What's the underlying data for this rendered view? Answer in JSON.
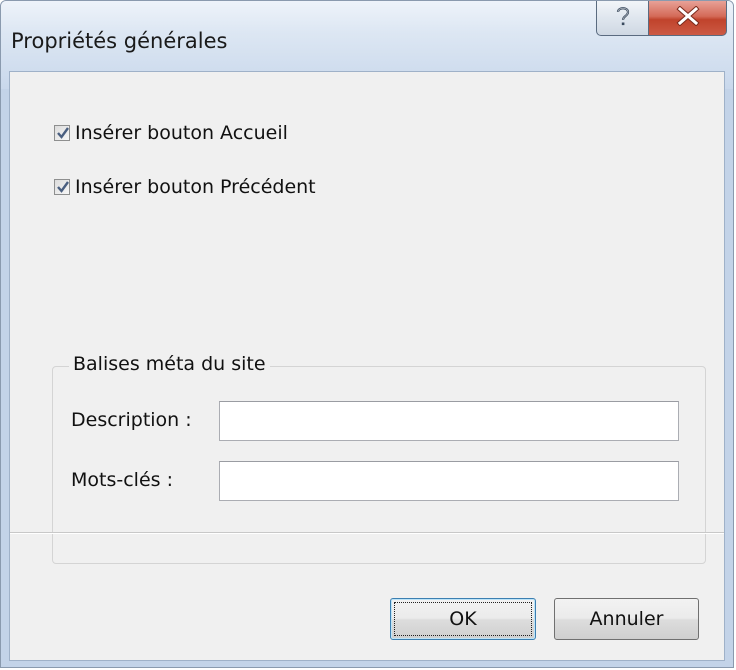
{
  "window": {
    "title": "Propriétés générales",
    "help_icon": "question-mark-icon",
    "close_icon": "close-x-icon"
  },
  "options": [
    {
      "label": "Insérer bouton Accueil",
      "checked": true
    },
    {
      "label": "Insérer bouton Précédent",
      "checked": true
    }
  ],
  "meta_group": {
    "legend": "Balises méta du site",
    "fields": [
      {
        "label": "Description :",
        "value": "",
        "placeholder": ""
      },
      {
        "label": "Mots-clés :",
        "value": "",
        "placeholder": ""
      }
    ]
  },
  "buttons": {
    "ok_label": "OK",
    "cancel_label": "Annuler"
  },
  "colors": {
    "close_button": "#c9503a",
    "client_background": "#f0f0f0",
    "frame_background": "#c3d3e8"
  }
}
